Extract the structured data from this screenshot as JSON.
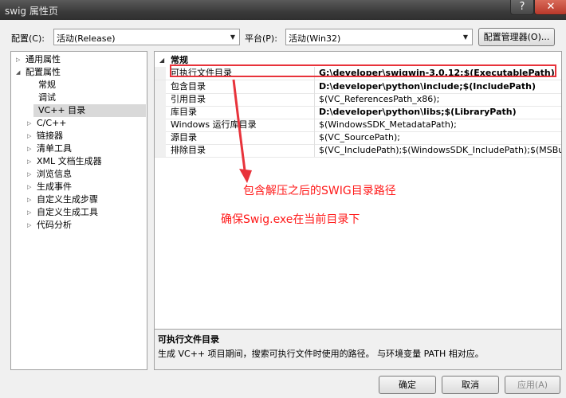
{
  "window": {
    "title": "swig 属性页",
    "help": "?",
    "close": "✕"
  },
  "toolbar": {
    "config_label": "配置(C):",
    "config_value": "活动(Release)",
    "platform_label": "平台(P):",
    "platform_value": "活动(Win32)",
    "config_manager": "配置管理器(O)..."
  },
  "tree": {
    "items": [
      {
        "label": "通用属性",
        "expander": "▷"
      },
      {
        "label": "配置属性",
        "expander": "◢"
      },
      {
        "label": "常规",
        "expander": ""
      },
      {
        "label": "调试",
        "expander": ""
      },
      {
        "label": "VC++ 目录",
        "expander": ""
      },
      {
        "label": "C/C++",
        "expander": "▷"
      },
      {
        "label": "链接器",
        "expander": "▷"
      },
      {
        "label": "清单工具",
        "expander": "▷"
      },
      {
        "label": "XML 文档生成器",
        "expander": "▷"
      },
      {
        "label": "浏览信息",
        "expander": "▷"
      },
      {
        "label": "生成事件",
        "expander": "▷"
      },
      {
        "label": "自定义生成步骤",
        "expander": "▷"
      },
      {
        "label": "自定义生成工具",
        "expander": "▷"
      },
      {
        "label": "代码分析",
        "expander": "▷"
      }
    ],
    "selected": "VC++ 目录"
  },
  "grid": {
    "category": "常规",
    "category_expander": "◢",
    "rows": [
      {
        "name": "可执行文件目录",
        "value": "G:\\developer\\swigwin-3.0.12;$(ExecutablePath)"
      },
      {
        "name": "包含目录",
        "value": "D:\\developer\\python\\include;$(IncludePath)"
      },
      {
        "name": "引用目录",
        "value": "$(VC_ReferencesPath_x86);"
      },
      {
        "name": "库目录",
        "value": "D:\\developer\\python\\libs;$(LibraryPath)"
      },
      {
        "name": "Windows 运行库目录",
        "value": "$(WindowsSDK_MetadataPath);"
      },
      {
        "name": "源目录",
        "value": "$(VC_SourcePath);"
      },
      {
        "name": "排除目录",
        "value": "$(VC_IncludePath);$(WindowsSDK_IncludePath);$(MSBuild"
      }
    ]
  },
  "annotations": {
    "line1": "包含解压之后的SWIG目录路径",
    "line2": "确保Swig.exe在当前目录下",
    "color": "#ff1a1a"
  },
  "description": {
    "title": "可执行文件目录",
    "text": "生成 VC++ 项目期间，搜索可执行文件时使用的路径。 与环境变量 PATH 相对应。"
  },
  "buttons": {
    "ok": "确定",
    "cancel": "取消",
    "apply": "应用(A)"
  }
}
